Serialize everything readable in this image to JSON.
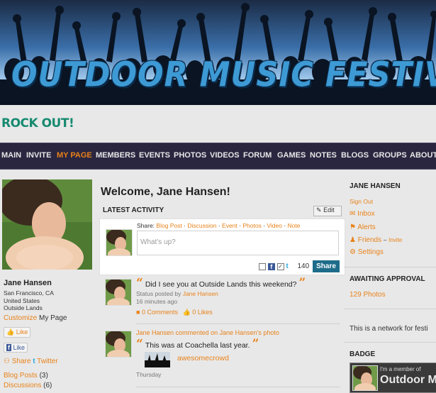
{
  "banner": {
    "title": "OUTDOOR MUSIC FESTIVALS"
  },
  "tagline": "ROCK OUT!",
  "nav": {
    "items": [
      "MAIN",
      "INVITE",
      "MY PAGE",
      "MEMBERS",
      "EVENTS",
      "PHOTOS",
      "VIDEOS",
      "FORUM",
      "GAMES",
      "NOTES",
      "BLOGS",
      "GROUPS",
      "ABOUT"
    ],
    "active": "MY PAGE"
  },
  "profile": {
    "name": "Jane Hansen",
    "location": [
      "San Francisco, CA",
      "United States",
      "Outside Lands"
    ],
    "customize": "Customize",
    "my_page": "My Page",
    "like": "Like",
    "fb_like": "Like",
    "share": "Share",
    "twitter": "Twitter",
    "blog_posts": "Blog Posts",
    "blog_posts_count": "(3)",
    "discussions": "Discussions",
    "discussions_count": "(6)"
  },
  "main": {
    "welcome": "Welcome, Jane Hansen!",
    "latest_activity": "LATEST ACTIVITY",
    "edit": "Edit",
    "share_label": "Share:",
    "share_types": [
      "Blog Post",
      "Discussion",
      "Event",
      "Photos",
      "Video",
      "Note"
    ],
    "placeholder": "What's up?",
    "char_count": "140",
    "share_button": "Share",
    "activity": [
      {
        "text": "Did I see you at Outside Lands this weekend?",
        "status_prefix": "Status posted by",
        "author": "Jane Hansen",
        "time": "16 minutes ago",
        "comments": "0 Comments",
        "likes": "0 Likes"
      },
      {
        "actor": "Jane Hansen",
        "verb": "commented on",
        "target": "Jane Hansen's photo",
        "text": "This was at Coachella last year.",
        "photo_caption": "awesomecrowd",
        "time": "Thursday"
      }
    ]
  },
  "sidebar": {
    "user_heading": "JANE HANSEN",
    "sign_out": "Sign Out",
    "inbox": "Inbox",
    "alerts": "Alerts",
    "friends": "Friends",
    "invite": "Invite",
    "settings": "Settings",
    "awaiting_heading": "AWAITING APPROVAL",
    "awaiting_photos": "129 Photos",
    "network_text": "This is a network for festi",
    "badge_heading": "BADGE",
    "badge_member": "I'm a member of",
    "badge_network": "Outdoor M"
  },
  "colors": {
    "accent": "#e8821a",
    "nav_bg": "#2b2640",
    "share_button": "#1e6c8a",
    "tagline": "#168a70"
  }
}
